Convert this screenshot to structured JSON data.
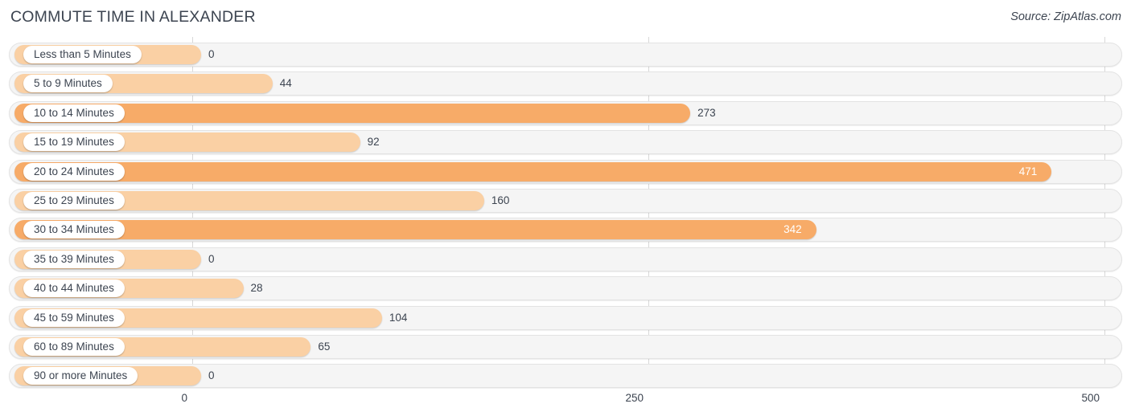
{
  "header": {
    "title": "COMMUTE TIME IN ALEXANDER",
    "source": "Source: ZipAtlas.com"
  },
  "axis": {
    "ticks": [
      "0",
      "250",
      "500"
    ],
    "tick_values": [
      0,
      250,
      500
    ]
  },
  "colors": {
    "bar_high": "#f7ab68",
    "bar_low": "#fad0a4",
    "track": "#f5f5f5",
    "track_border": "#e3e3e3",
    "gridline": "#d8d8d8",
    "text": "#3c4450",
    "value_inside": "#ffffff"
  },
  "chart_data": {
    "type": "bar",
    "orientation": "horizontal",
    "title": "COMMUTE TIME IN ALEXANDER",
    "xlabel": "",
    "ylabel": "",
    "xlim": [
      0,
      500
    ],
    "grid": true,
    "legend": false,
    "categories": [
      "Less than 5 Minutes",
      "5 to 9 Minutes",
      "10 to 14 Minutes",
      "15 to 19 Minutes",
      "20 to 24 Minutes",
      "25 to 29 Minutes",
      "30 to 34 Minutes",
      "35 to 39 Minutes",
      "40 to 44 Minutes",
      "45 to 59 Minutes",
      "60 to 89 Minutes",
      "90 or more Minutes"
    ],
    "values": [
      0,
      44,
      273,
      92,
      471,
      160,
      342,
      0,
      28,
      104,
      65,
      0
    ],
    "labels": [
      "0",
      "44",
      "273",
      "92",
      "471",
      "160",
      "342",
      "0",
      "28",
      "104",
      "65",
      "0"
    ]
  },
  "rows": [
    {
      "label": "Less than 5 Minutes",
      "value": 0,
      "display": "0",
      "shade": "lo",
      "inside": false
    },
    {
      "label": "5 to 9 Minutes",
      "value": 44,
      "display": "44",
      "shade": "lo",
      "inside": false
    },
    {
      "label": "10 to 14 Minutes",
      "value": 273,
      "display": "273",
      "shade": "hi",
      "inside": false
    },
    {
      "label": "15 to 19 Minutes",
      "value": 92,
      "display": "92",
      "shade": "lo",
      "inside": false
    },
    {
      "label": "20 to 24 Minutes",
      "value": 471,
      "display": "471",
      "shade": "hi",
      "inside": true
    },
    {
      "label": "25 to 29 Minutes",
      "value": 160,
      "display": "160",
      "shade": "lo",
      "inside": false
    },
    {
      "label": "30 to 34 Minutes",
      "value": 342,
      "display": "342",
      "shade": "hi",
      "inside": true
    },
    {
      "label": "35 to 39 Minutes",
      "value": 0,
      "display": "0",
      "shade": "lo",
      "inside": false
    },
    {
      "label": "40 to 44 Minutes",
      "value": 28,
      "display": "28",
      "shade": "lo",
      "inside": false
    },
    {
      "label": "45 to 59 Minutes",
      "value": 104,
      "display": "104",
      "shade": "lo",
      "inside": false
    },
    {
      "label": "60 to 89 Minutes",
      "value": 65,
      "display": "65",
      "shade": "lo",
      "inside": false
    },
    {
      "label": "90 or more Minutes",
      "value": 0,
      "display": "0",
      "shade": "lo",
      "inside": false
    }
  ]
}
